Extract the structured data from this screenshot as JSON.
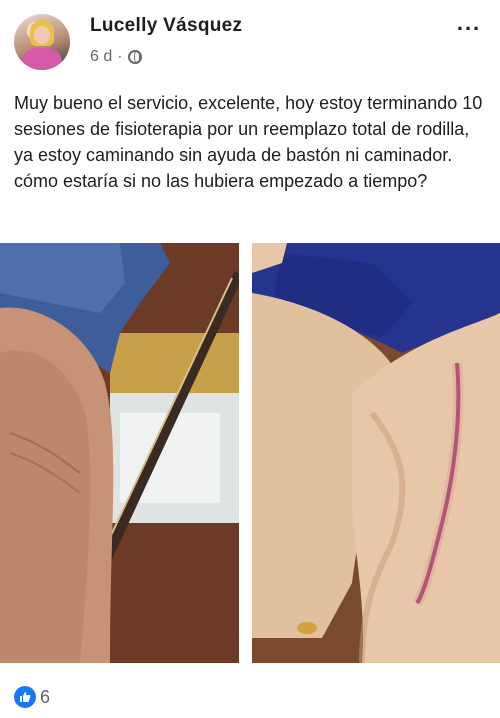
{
  "post": {
    "author_name": "Lucelly Vásquez",
    "timestamp": "6 d",
    "privacy_icon": "globe-icon",
    "options_label": "...",
    "text": "Muy bueno el servicio, excelente, hoy estoy terminando 10 sesiones de fisioterapia por un reemplazo total de rodilla, ya estoy caminando sin ayuda de bastón ni caminador. cómo estaría si no las hubiera empezado a tiempo?"
  },
  "photos": [
    {
      "icon": "knee-photo-before"
    },
    {
      "icon": "knee-photo-scar"
    }
  ],
  "reactions": {
    "icon": "like-icon",
    "count": "6",
    "color": "#1877f2"
  }
}
